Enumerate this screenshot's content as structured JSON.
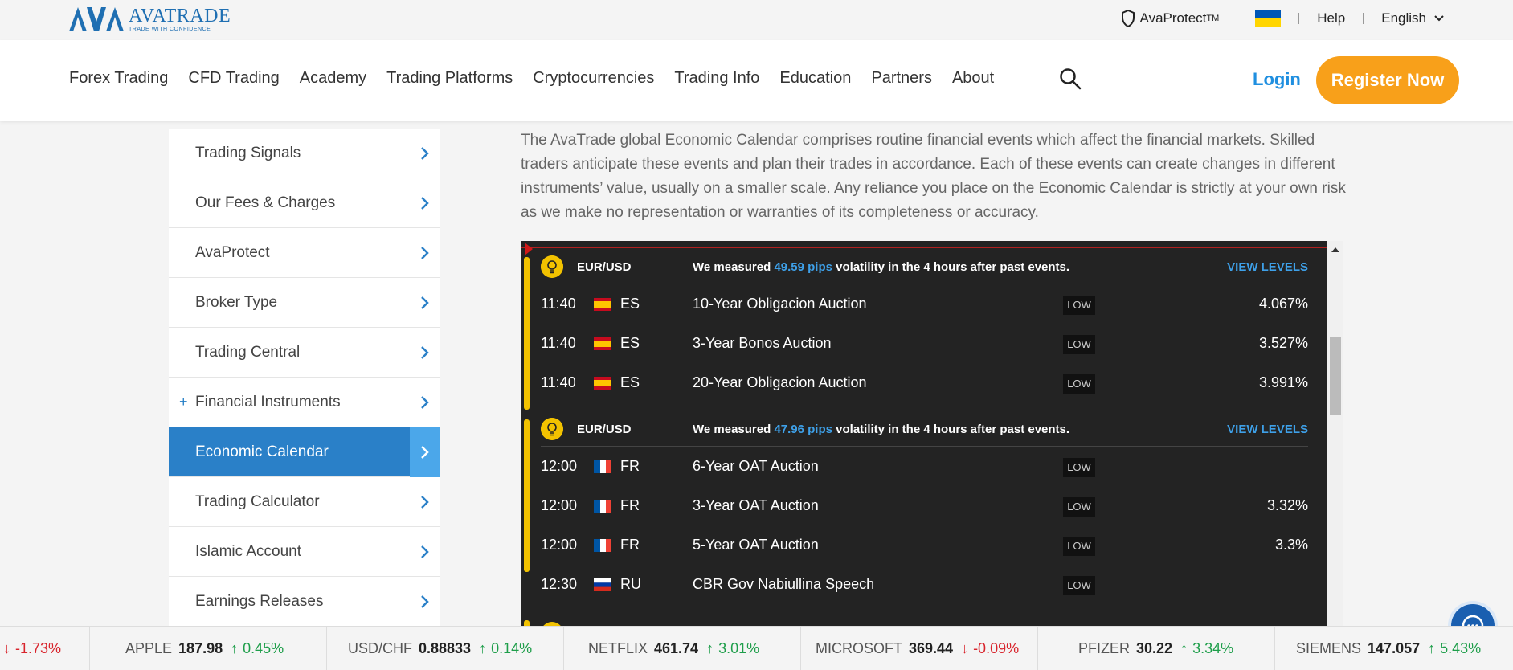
{
  "brand": {
    "name": "AVATRADE",
    "tagline": "TRADE WITH CONFIDENCE"
  },
  "topbar": {
    "avaprotect": "AvaProtect",
    "tm": "TM",
    "help": "Help",
    "language": "English"
  },
  "nav": {
    "items": [
      "Forex Trading",
      "CFD Trading",
      "Academy",
      "Trading Platforms",
      "Cryptocurrencies",
      "Trading Info",
      "Education",
      "Partners",
      "About"
    ],
    "login": "Login",
    "register": "Register Now"
  },
  "sidebar": {
    "items": [
      {
        "label": "Trading Signals",
        "prefix": ""
      },
      {
        "label": "Our Fees & Charges",
        "prefix": ""
      },
      {
        "label": "AvaProtect",
        "prefix": ""
      },
      {
        "label": "Broker Type",
        "prefix": ""
      },
      {
        "label": "Trading Central",
        "prefix": ""
      },
      {
        "label": "Financial Instruments",
        "prefix": "+"
      },
      {
        "label": "Economic Calendar",
        "prefix": "",
        "active": true
      },
      {
        "label": "Trading Calculator",
        "prefix": ""
      },
      {
        "label": "Islamic Account",
        "prefix": ""
      },
      {
        "label": "Earnings Releases",
        "prefix": ""
      }
    ]
  },
  "intro": "The AvaTrade global Economic Calendar comprises routine financial events which affect the financial markets. Skilled traders anticipate these events and plan their trades in accordance. Each of these events can create changes in different instruments’ value, usually on a smaller scale. Any reliance you place on the Economic Calendar is strictly at your own risk as we make no representation or warranties of its completeness or accuracy.",
  "calendar": {
    "groups": [
      {
        "pair": "EUR/USD",
        "measure_prefix": "We measured ",
        "pips": "49.59 pips",
        "measure_suffix": " volatility in the 4 hours after past events.",
        "view": "VIEW LEVELS",
        "events": [
          {
            "time": "11:40",
            "country": "ES",
            "flag": "spain-flag-icon",
            "name": "10-Year Obligacion Auction",
            "impact": "LOW",
            "value": "4.067%"
          },
          {
            "time": "11:40",
            "country": "ES",
            "flag": "spain-flag-icon",
            "name": "3-Year Bonos Auction",
            "impact": "LOW",
            "value": "3.527%"
          },
          {
            "time": "11:40",
            "country": "ES",
            "flag": "spain-flag-icon",
            "name": "20-Year Obligacion Auction",
            "impact": "LOW",
            "value": "3.991%"
          }
        ]
      },
      {
        "pair": "EUR/USD",
        "measure_prefix": "We measured ",
        "pips": "47.96 pips",
        "measure_suffix": " volatility in the 4 hours after past events.",
        "view": "VIEW LEVELS",
        "events": [
          {
            "time": "12:00",
            "country": "FR",
            "flag": "france-flag-icon",
            "name": "6-Year OAT Auction",
            "impact": "LOW",
            "value": ""
          },
          {
            "time": "12:00",
            "country": "FR",
            "flag": "france-flag-icon",
            "name": "3-Year OAT Auction",
            "impact": "LOW",
            "value": "3.32%"
          },
          {
            "time": "12:00",
            "country": "FR",
            "flag": "france-flag-icon",
            "name": "5-Year OAT Auction",
            "impact": "LOW",
            "value": "3.3%"
          }
        ]
      }
    ],
    "standalone": {
      "time": "12:30",
      "country": "RU",
      "flag": "russia-flag-icon",
      "name": "CBR Gov Nabiullina Speech",
      "impact": "LOW",
      "value": ""
    }
  },
  "ticker": [
    {
      "name": "",
      "price": "",
      "change": "-1.73%",
      "dir": "down"
    },
    {
      "name": "APPLE",
      "price": "187.98",
      "change": "0.45%",
      "dir": "up"
    },
    {
      "name": "USD/CHF",
      "price": "0.88833",
      "change": "0.14%",
      "dir": "up"
    },
    {
      "name": "NETFLIX",
      "price": "461.74",
      "change": "3.01%",
      "dir": "up"
    },
    {
      "name": "MICROSOFT",
      "price": "369.44",
      "change": "-0.09%",
      "dir": "down"
    },
    {
      "name": "PFIZER",
      "price": "30.22",
      "change": "3.34%",
      "dir": "up"
    },
    {
      "name": "SIEMENS",
      "price": "147.057",
      "change": "5.43%",
      "dir": "up"
    }
  ],
  "colors": {
    "brand_blue": "#1f6fb2",
    "accent_orange": "#f8a01a",
    "active_blue": "#2a80c8",
    "up_green": "#1e9e4a",
    "down_red": "#d8242c",
    "calendar_bg": "#232323",
    "highlight_yellow": "#f2c200"
  }
}
